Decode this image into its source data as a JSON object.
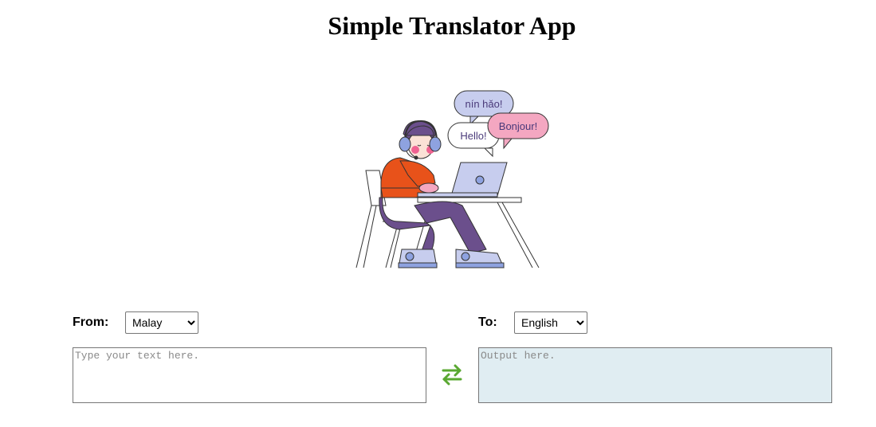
{
  "header": {
    "title": "Simple Translator App"
  },
  "illustration": {
    "bubbles": [
      "nín hǎo!",
      "Hello!",
      "Bonjour!"
    ]
  },
  "from": {
    "label": "From:",
    "selected": "Malay",
    "options": [
      "Malay"
    ]
  },
  "to": {
    "label": "To:",
    "selected": "English",
    "options": [
      "English"
    ]
  },
  "input": {
    "placeholder": "Type your text here.",
    "value": ""
  },
  "output": {
    "placeholder": "Output here.",
    "value": ""
  },
  "swap": {
    "icon": "swap-arrows-icon",
    "color": "#5aa832"
  },
  "colors": {
    "sweater": "#e8521a",
    "pants": "#6b4f8c",
    "laptop": "#c7cdee",
    "bubble_blue": "#c7cdee",
    "bubble_pink": "#f4a7c1",
    "output_bg": "#e0edf2"
  }
}
